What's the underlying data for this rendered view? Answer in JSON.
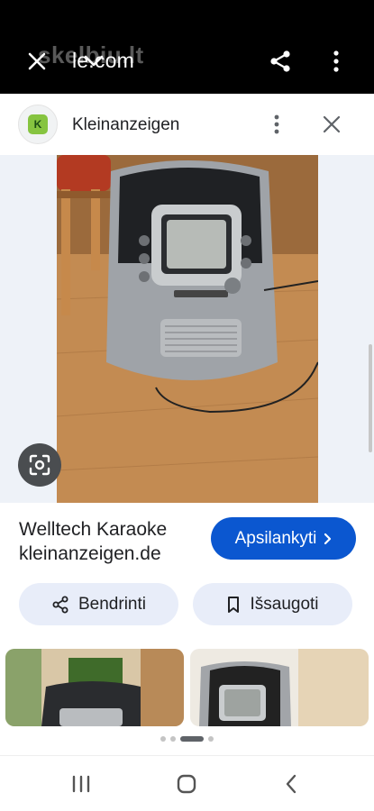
{
  "topbar": {
    "url": "le.com",
    "watermark": "skelbiu.lt",
    "icons": [
      "close-icon",
      "chevron-down-icon",
      "share-icon",
      "more-vert-icon"
    ]
  },
  "source": {
    "name": "Kleinanzeigen",
    "icons": [
      "more-vert-icon",
      "close-icon"
    ]
  },
  "result": {
    "title": "Welltech Karaoke",
    "domain": "kleinanzeigen.de",
    "visit_label": "Apsilankyti",
    "share_label": "Bendrinti",
    "save_label": "Išsaugoti"
  },
  "colors": {
    "accent": "#0b57d0",
    "pill_bg": "#e8edf9",
    "topbar": "#000000"
  },
  "pagination": {
    "count": 4,
    "active": 2
  },
  "navbar": {
    "icons": [
      "recent-apps-icon",
      "home-icon",
      "back-icon"
    ]
  }
}
